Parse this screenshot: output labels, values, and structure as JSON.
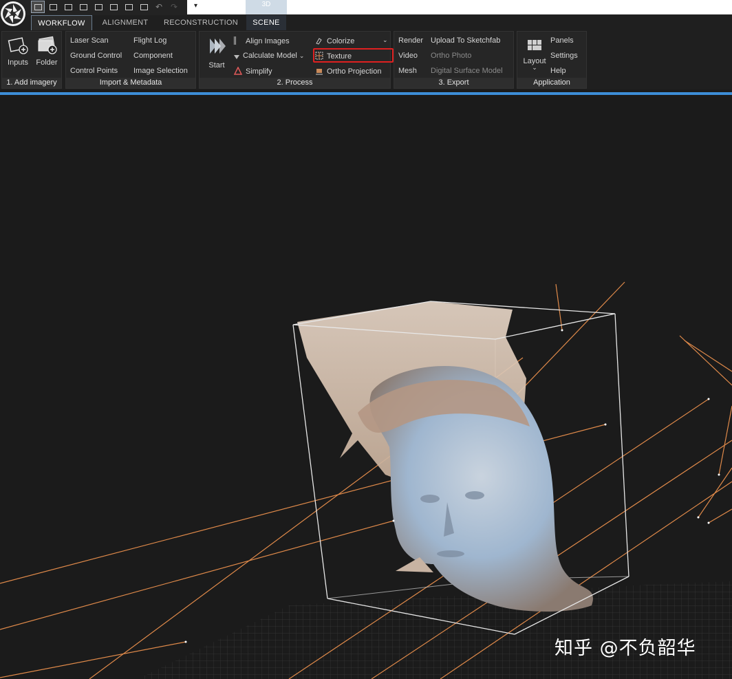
{
  "quick_access": {
    "view_3d_label": "3D",
    "dropdown_glyph": "▾"
  },
  "tabs": [
    {
      "label": "WORKFLOW",
      "active": true
    },
    {
      "label": "ALIGNMENT",
      "active": false
    },
    {
      "label": "RECONSTRUCTION",
      "active": false
    },
    {
      "label": "SCENE",
      "active": false
    }
  ],
  "ribbon": {
    "add_imagery": {
      "title": "1. Add imagery",
      "inputs": "Inputs",
      "folder": "Folder"
    },
    "import_metadata": {
      "title": "Import & Metadata",
      "laser_scan": "Laser Scan",
      "ground_control": "Ground Control",
      "control_points": "Control Points",
      "flight_log": "Flight Log",
      "component": "Component",
      "image_selection": "Image Selection"
    },
    "process": {
      "title": "2. Process",
      "start": "Start",
      "align_images": "Align Images",
      "calculate_model": "Calculate Model",
      "simplify": "Simplify",
      "colorize": "Colorize",
      "texture": "Texture",
      "ortho_projection": "Ortho Projection"
    },
    "export": {
      "title": "3. Export",
      "render": "Render",
      "video": "Video",
      "mesh": "Mesh",
      "upload_sketchfab": "Upload To Sketchfab",
      "ortho_photo": "Ortho Photo",
      "dsm": "Digital Surface Model"
    },
    "application": {
      "title": "Application",
      "layout": "Layout",
      "panels": "Panels",
      "settings": "Settings",
      "help": "Help"
    }
  },
  "colors": {
    "accent_blue": "#3d8ed8",
    "highlight_red": "#e02020",
    "camera_ray_orange": "#e08a4a"
  },
  "watermark": "知乎 @不负韶华"
}
